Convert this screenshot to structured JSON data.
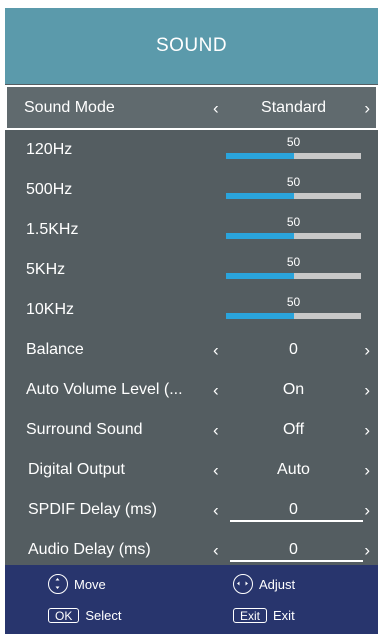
{
  "header": {
    "title": "SOUND"
  },
  "menu": {
    "sound_mode": {
      "label": "Sound Mode",
      "value": "Standard"
    },
    "eq": [
      {
        "label": "120Hz",
        "value": "50",
        "level": 0.5
      },
      {
        "label": "500Hz",
        "value": "50",
        "level": 0.5
      },
      {
        "label": "1.5KHz",
        "value": "50",
        "level": 0.5
      },
      {
        "label": "5KHz",
        "value": "50",
        "level": 0.5
      },
      {
        "label": "10KHz",
        "value": "50",
        "level": 0.5
      }
    ],
    "balance": {
      "label": "Balance",
      "value": "0"
    },
    "auto_volume": {
      "label": "Auto Volume Level (...",
      "value": "On"
    },
    "surround": {
      "label": "Surround Sound",
      "value": "Off"
    },
    "digital_output": {
      "label": "Digital Output",
      "value": "Auto"
    },
    "spdif_delay": {
      "label": "SPDIF Delay (ms)",
      "value": "0"
    },
    "audio_delay": {
      "label": "Audio Delay (ms)",
      "value": "0"
    }
  },
  "arrows": {
    "left": "‹",
    "right": "›"
  },
  "footer": {
    "move": "Move",
    "adjust": "Adjust",
    "ok_key": "OK",
    "select": "Select",
    "exit_key": "Exit",
    "exit": "Exit"
  },
  "colors": {
    "header_bg": "#5b9aab",
    "menu_bg": "#545d61",
    "footer_bg": "#28356d",
    "slider_fill": "#2aa4dc",
    "slider_track": "#c8c8c8"
  }
}
